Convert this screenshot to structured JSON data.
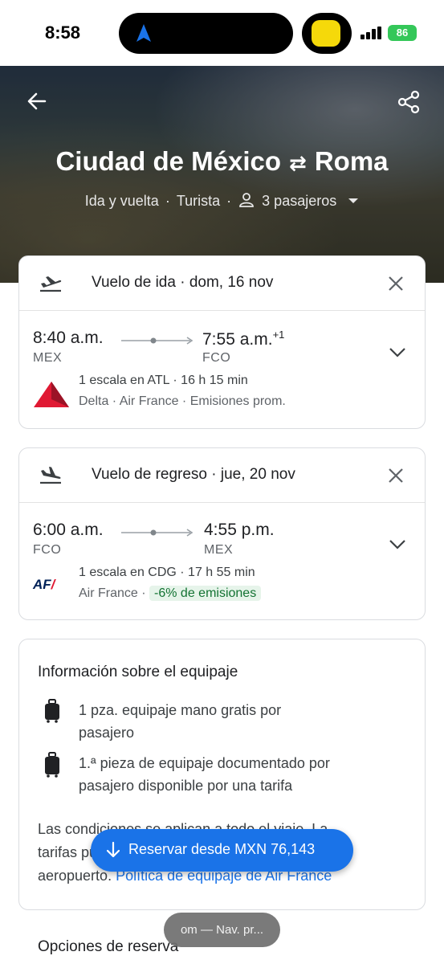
{
  "status_bar": {
    "time": "8:58",
    "battery": "86"
  },
  "header": {
    "origin": "Ciudad de México",
    "swap_symbol": "⇄",
    "destination": "Roma",
    "trip_type": "Ida y vuelta",
    "cabin": "Turista",
    "passengers": "3 pasajeros"
  },
  "outbound": {
    "title": "Vuelo de ida · dom, 16 nov",
    "depart_time": "8:40 a.m.",
    "arrive_time": "7:55 a.m.",
    "day_offset": "+1",
    "depart_code": "MEX",
    "arrive_code": "FCO",
    "stops": "1 escala en ATL · 16 h 15 min",
    "airlines": "Delta · Air France · Emisiones prom.",
    "logo_color": "#e01933"
  },
  "return": {
    "title": "Vuelo de regreso · jue, 20 nov",
    "depart_time": "6:00 a.m.",
    "arrive_time": "4:55 p.m.",
    "depart_code": "FCO",
    "arrive_code": "MEX",
    "stops": "1 escala en CDG · 17 h 55 min",
    "airlines": "Air France ·",
    "emissions": "-6% de emisiones",
    "logo_text": "AF"
  },
  "baggage": {
    "title": "Información sobre el equipaje",
    "carry_on_line1": "1 pza. equipaje mano gratis por",
    "carry_on_line2": "pasajero",
    "checked_line1": "1.ª pieza de equipaje documentado por",
    "checked_line2": "pasajero disponible por una tarifa",
    "conditions_line1": "Las condiciones se aplican a todo el viaje. La",
    "conditions_line2": "tarifas pueden variar en el mostrador en el",
    "conditions_line3_text": "aeropuerto.",
    "conditions_link": "Política de equipaje de Air France"
  },
  "booking_options_label": "Opciones de reserva",
  "fab_label": "Reservar desde MXN 76,143",
  "bottom_pill": "om — Nav. pr..."
}
